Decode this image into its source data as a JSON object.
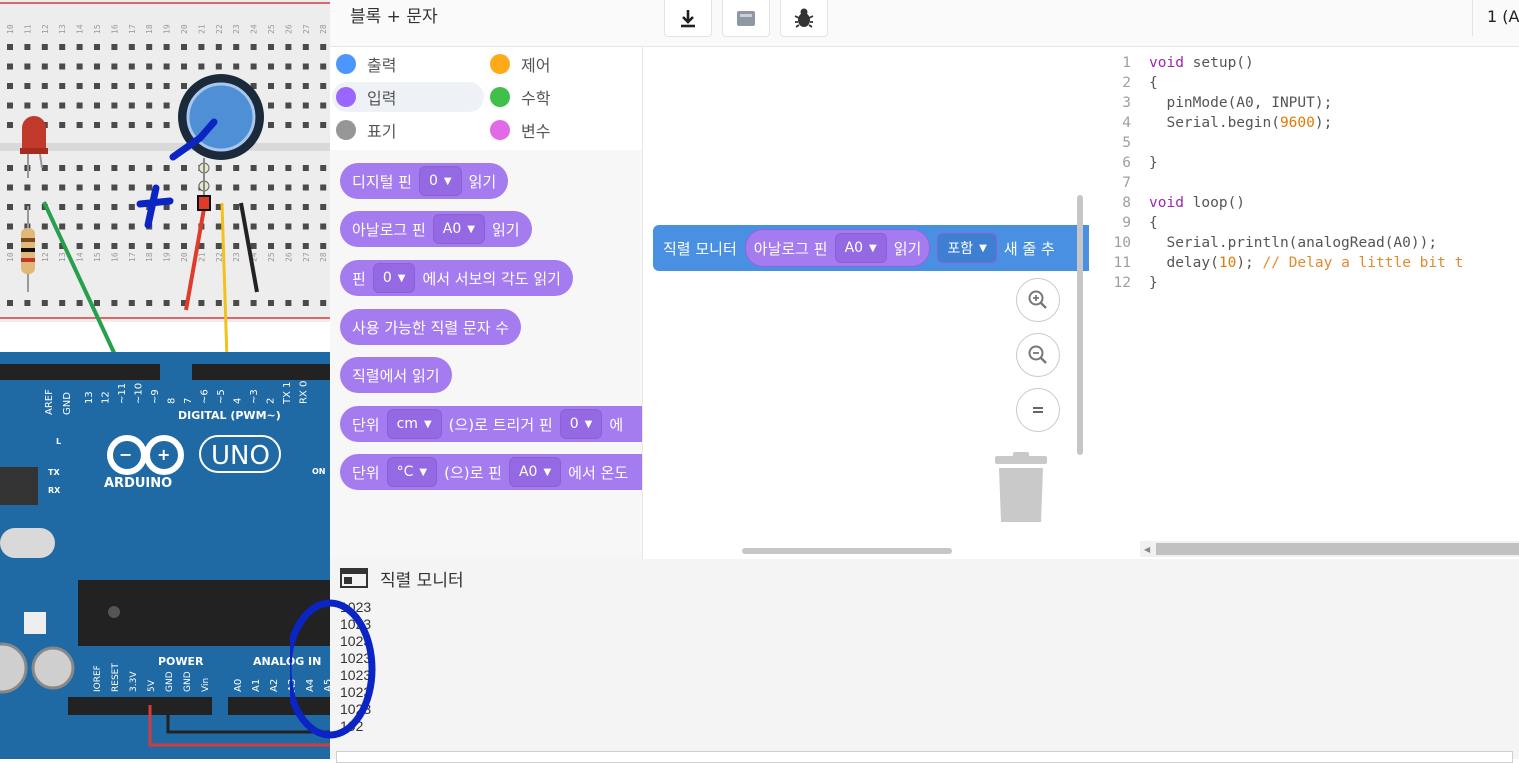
{
  "toolbar": {
    "mode_label": "블록 + 문자",
    "board_select": "1 (A"
  },
  "categories": [
    {
      "label": "출력",
      "color": "#4c97ff"
    },
    {
      "label": "제어",
      "color": "#ffab19"
    },
    {
      "label": "입력",
      "color": "#9966ff"
    },
    {
      "label": "수학",
      "color": "#40bf4a"
    },
    {
      "label": "표기",
      "color": "#969696"
    },
    {
      "label": "변수",
      "color": "#e26ae6"
    }
  ],
  "palette": {
    "b1": {
      "pre": "디지털 핀",
      "dd": "0",
      "post": "읽기"
    },
    "b2": {
      "pre": "아날로그 핀",
      "dd": "A0",
      "post": "읽기"
    },
    "b3": {
      "pre": "핀",
      "dd": "0",
      "post": "에서 서보의 각도 읽기"
    },
    "b4": {
      "label": "사용 가능한 직렬 문자 수"
    },
    "b5": {
      "label": "직렬에서 읽기"
    },
    "b6": {
      "pre": "단위",
      "dd1": "cm",
      "mid": "(으)로 트리거 핀",
      "dd2": "0",
      "post": "에"
    },
    "b7": {
      "pre": "단위",
      "dd1": "°C",
      "mid": "(으)로 핀",
      "dd2": "A0",
      "post": "에서 온도"
    }
  },
  "workspace": {
    "block": {
      "label": "직렬 모니터",
      "inner_pre": "아날로그 핀",
      "inner_dd": "A0",
      "inner_post": "읽기",
      "dd_include": "포함",
      "tail": "새 줄 추"
    }
  },
  "code": {
    "lines": [
      {
        "n": "1",
        "t": "void setup()"
      },
      {
        "n": "2",
        "t": "{"
      },
      {
        "n": "3",
        "t": "  pinMode(A0, INPUT);"
      },
      {
        "n": "4",
        "t": "  Serial.begin(9600);"
      },
      {
        "n": "5",
        "t": ""
      },
      {
        "n": "6",
        "t": "}"
      },
      {
        "n": "7",
        "t": ""
      },
      {
        "n": "8",
        "t": "void loop()"
      },
      {
        "n": "9",
        "t": "{"
      },
      {
        "n": "10",
        "t": "  Serial.println(analogRead(A0));"
      },
      {
        "n": "11",
        "t": "  delay(10); // Delay a little bit t"
      },
      {
        "n": "12",
        "t": "}"
      }
    ]
  },
  "serial": {
    "title": "직렬 모니터",
    "lines": [
      "1023",
      "1023",
      "1023",
      "1023",
      "1023",
      "1023",
      "1023",
      "102"
    ]
  },
  "board": {
    "brand": "ARDUINO",
    "model": "UNO",
    "digital_label": "DIGITAL (PWM~)",
    "power_label": "POWER",
    "analog_label": "ANALOG IN",
    "aref": "AREF",
    "gnd": "GND",
    "tx": "TX",
    "rx": "RX",
    "l": "L",
    "on": "ON",
    "power_pins": [
      "IOREF",
      "RESET",
      "3.3V",
      "5V",
      "GND",
      "GND",
      "Vin"
    ],
    "analog_pins": [
      "A0",
      "A1",
      "A2",
      "A3",
      "A4",
      "A5"
    ],
    "digital_pins": [
      "13",
      "12",
      "~11",
      "~10",
      "~9",
      "8",
      "7",
      "~6",
      "~5",
      "4",
      "~3",
      "2",
      "TX 1",
      "RX 0"
    ],
    "breadboard_cols": [
      "10",
      "11",
      "12",
      "13",
      "14",
      "15",
      "16",
      "17",
      "18",
      "19",
      "20",
      "21",
      "22",
      "23",
      "24",
      "25",
      "26",
      "27",
      "28",
      "29"
    ]
  },
  "colors": {
    "input_block": "#a57bf0",
    "serial_block": "#4a90e2",
    "annotation_marker": "#0b24c4",
    "board": "#1f6aa5"
  },
  "icons": [
    "download-icon",
    "components-icon",
    "debug-bug-icon",
    "zoom-in-icon",
    "zoom-out-icon",
    "zoom-reset-icon",
    "trash-icon",
    "serial-monitor-icon"
  ]
}
